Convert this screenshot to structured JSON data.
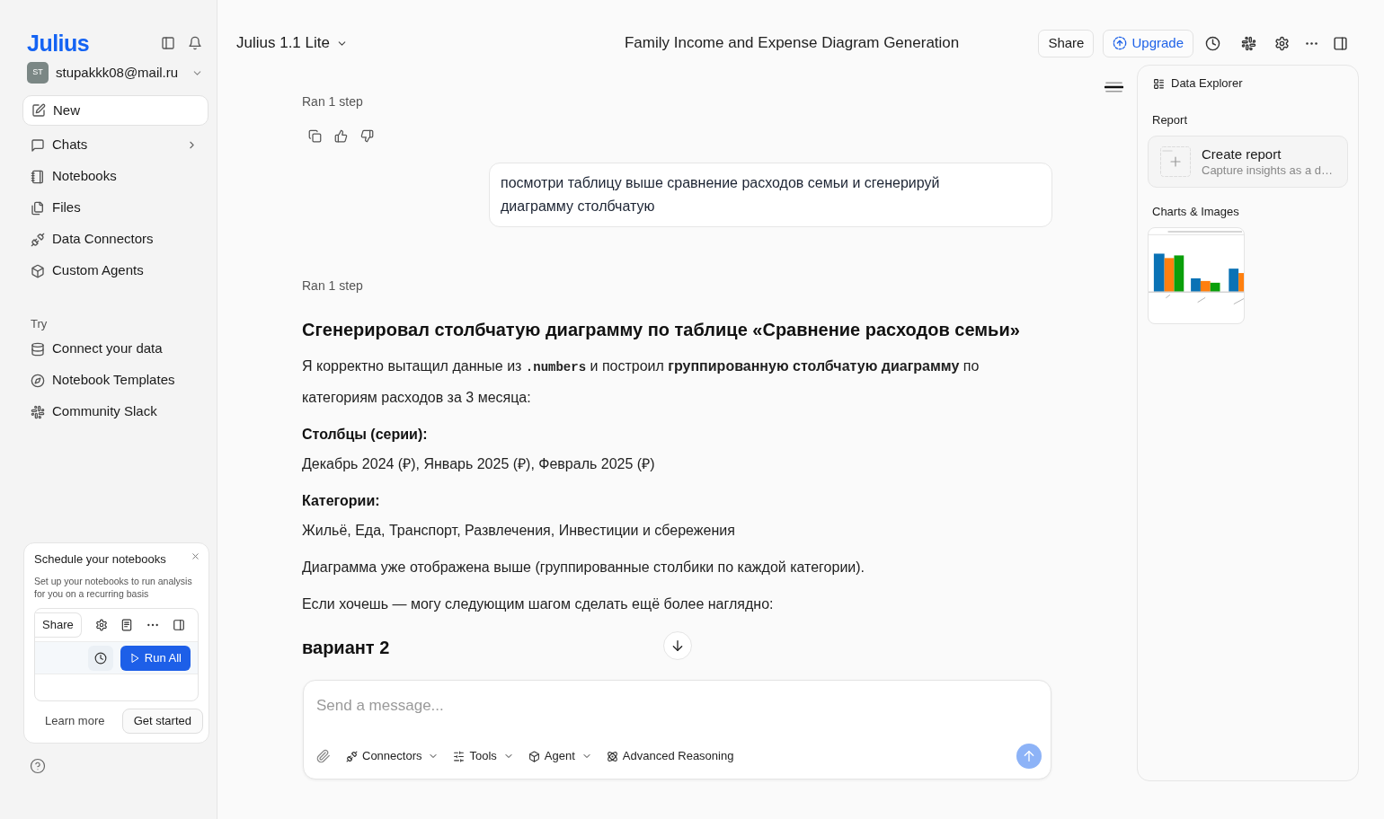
{
  "sidebar": {
    "logo": "Julius",
    "account": {
      "initials": "ST",
      "email": "stupakkk08@mail.ru"
    },
    "new_button": "New",
    "nav_items": [
      {
        "label": "Chats",
        "submenu": true
      },
      {
        "label": "Notebooks",
        "submenu": false
      },
      {
        "label": "Files",
        "submenu": false
      },
      {
        "label": "Data Connectors",
        "submenu": false
      },
      {
        "label": "Custom Agents",
        "submenu": false
      }
    ],
    "try_section": {
      "title": "Try",
      "items": [
        "Connect your data",
        "Notebook Templates",
        "Community Slack"
      ]
    },
    "promo_card": {
      "title": "Schedule your notebooks",
      "description": "Set up your notebooks to run analysis for you on a recurring basis",
      "preview": {
        "share_button": "Share",
        "run_button": "Run All"
      },
      "learn_more": "Learn more",
      "get_started": "Get started"
    }
  },
  "header": {
    "model": "Julius 1.1 Lite",
    "title": "Family Income and Expense Diagram Generation",
    "share_button": "Share",
    "upgrade_button": "Upgrade"
  },
  "chat": {
    "messages": [
      {
        "kind": "status",
        "text": "Ran 1 step"
      },
      {
        "kind": "feedback_actions"
      },
      {
        "kind": "user",
        "text": "посмотри таблицу выше сравнение расходов семьи и сгенерируй диаграмму столбчатую"
      },
      {
        "kind": "status",
        "text": "Ran 1 step"
      },
      {
        "kind": "assistant",
        "blocks": [
          {
            "kind": "heading",
            "text": "Сгенерировал столбчатую диаграмму по таблице «Сравнение расходов семьи»"
          },
          {
            "kind": "paragraph",
            "parts": [
              {
                "kind": "text",
                "text": "Я корректно вытащил данные из "
              },
              {
                "kind": "code",
                "text": ".numbers"
              },
              {
                "kind": "text",
                "text": " и построил **группированную столбчатую диаграмму** по категориям расходов за 3 месяца:"
              }
            ]
          },
          {
            "kind": "label",
            "text": "Столбцы (серии):"
          },
          {
            "kind": "paragraph",
            "text": "Декабрь 2024 (₽), Январь 2025 (₽), Февраль 2025 (₽)"
          },
          {
            "kind": "label",
            "text": "Категории:"
          },
          {
            "kind": "paragraph",
            "text": "Жильё, Еда, Транспорт, Развлечения, Инвестиции и сбережения"
          },
          {
            "kind": "paragraph",
            "text": "Диаграмма уже отображена выше (группированные столбики по каждой категории)."
          },
          {
            "kind": "paragraph",
            "text": "Если хочешь — могу следующим шагом сделать ещё более наглядно:"
          },
          {
            "kind": "heading",
            "text": "вариант 2"
          }
        ]
      }
    ]
  },
  "composer": {
    "placeholder": "Send a message...",
    "tools": [
      {
        "label": "Connectors",
        "dropdown": true
      },
      {
        "label": "Tools",
        "dropdown": true
      },
      {
        "label": "Agent",
        "dropdown": true
      },
      {
        "label": "Advanced Reasoning",
        "dropdown": false
      }
    ]
  },
  "data_explorer": {
    "title": "Data Explorer",
    "report_label": "Report",
    "report_card": {
      "title": "Create report",
      "subtitle": "Capture insights as a d…"
    },
    "charts_label": "Charts & Images"
  }
}
